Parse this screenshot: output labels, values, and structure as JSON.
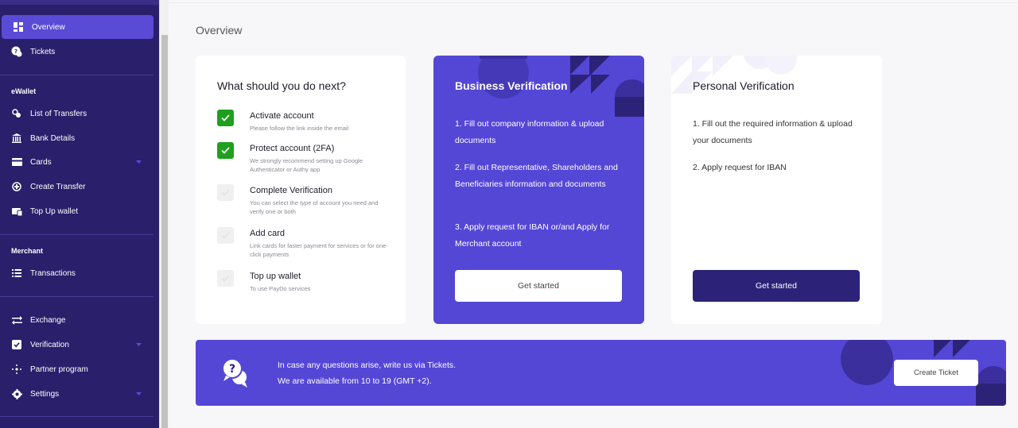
{
  "colors": {
    "sidebar_bg": "#2a1f6b",
    "accent": "#5447d6",
    "active_item": "#5a4bd6",
    "check_green": "#1ea01e",
    "dark_button": "#2c2378"
  },
  "sidebar": {
    "top_items": [
      {
        "label": "Overview",
        "icon": "dashboard-icon",
        "active": true
      },
      {
        "label": "Tickets",
        "icon": "help-chat-icon"
      }
    ],
    "ewallet_label": "eWallet",
    "ewallet_items": [
      {
        "label": "List of Transfers",
        "icon": "transfers-icon"
      },
      {
        "label": "Bank Details",
        "icon": "bank-icon"
      },
      {
        "label": "Cards",
        "icon": "card-icon",
        "expandable": true
      },
      {
        "label": "Create Transfer",
        "icon": "create-transfer-icon"
      },
      {
        "label": "Top Up wallet",
        "icon": "top-up-icon"
      }
    ],
    "merchant_label": "Merchant",
    "merchant_items": [
      {
        "label": "Transactions",
        "icon": "list-icon"
      }
    ],
    "bottom_items": [
      {
        "label": "Exchange",
        "icon": "exchange-icon"
      },
      {
        "label": "Verification",
        "icon": "verification-icon",
        "expandable": true
      },
      {
        "label": "Partner program",
        "icon": "partner-icon"
      },
      {
        "label": "Settings",
        "icon": "gear-icon",
        "expandable": true
      }
    ]
  },
  "main": {
    "page_title": "Overview",
    "next_card": {
      "title": "What should you do next?",
      "tasks": [
        {
          "title": "Activate account",
          "subtitle": "Please follow the link inside the email",
          "done": true
        },
        {
          "title": "Protect account (2FA)",
          "subtitle": "We strongly recommend setting up Google Authenticator or Authy app",
          "done": true
        },
        {
          "title": "Complete Verification",
          "subtitle": "You can select the type of account you need and verify one or both",
          "done": false
        },
        {
          "title": "Add card",
          "subtitle": "Link cards for faster payment for services or for one-click payments",
          "done": false
        },
        {
          "title": "Top up wallet",
          "subtitle": "To use PayDo services",
          "done": false
        }
      ]
    },
    "business_card": {
      "title": "Business Verification",
      "steps": [
        "1. Fill out company information & upload documents",
        "2. Fill out Representative, Shareholders and Beneficiaries information and documents",
        "3. Apply request for IBAN or/and Apply for Merchant account"
      ],
      "button": "Get started"
    },
    "personal_card": {
      "title": "Personal Verification",
      "steps": [
        "1. Fill out the required information & upload your documents",
        "2. Apply request for IBAN"
      ],
      "button": "Get started"
    },
    "banner": {
      "line1": "In case any questions arise, write us via Tickets.",
      "line2": "We are available from 10 to 19 (GMT +2).",
      "button": "Create Ticket"
    }
  }
}
